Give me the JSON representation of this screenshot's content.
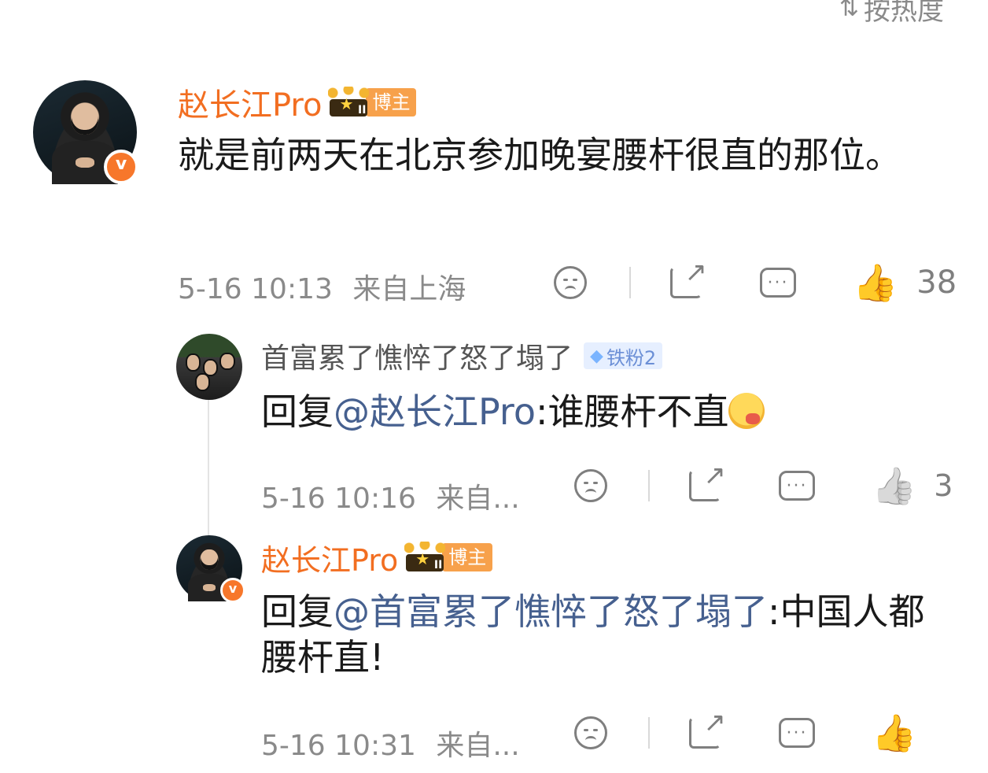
{
  "sort": {
    "label": "按热度"
  },
  "comments": [
    {
      "author": "赵长江Pro",
      "role": "博主",
      "text": "就是前两天在北京参加晚宴腰杆很直的那位。",
      "time": "5-16 10:13",
      "location": "来自上海",
      "likes": "38"
    },
    {
      "author": "首富累了憔悴了怒了塌了",
      "fan_badge": "铁粉2",
      "reply_prefix": "回复",
      "mention": "@赵长江Pro",
      "text": ":谁腰杆不直",
      "time": "5-16 10:16",
      "location": "来自...",
      "likes": "3"
    },
    {
      "author": "赵长江Pro",
      "role": "博主",
      "reply_prefix": "回复",
      "mention": "@首富累了憔悴了怒了塌了",
      "text": ":中国人都腰杆直!",
      "time": "5-16 10:31",
      "location": "来自..."
    }
  ],
  "colors": {
    "accent": "#f26e21",
    "mention": "#46608f",
    "meta": "#8a8a8a"
  }
}
